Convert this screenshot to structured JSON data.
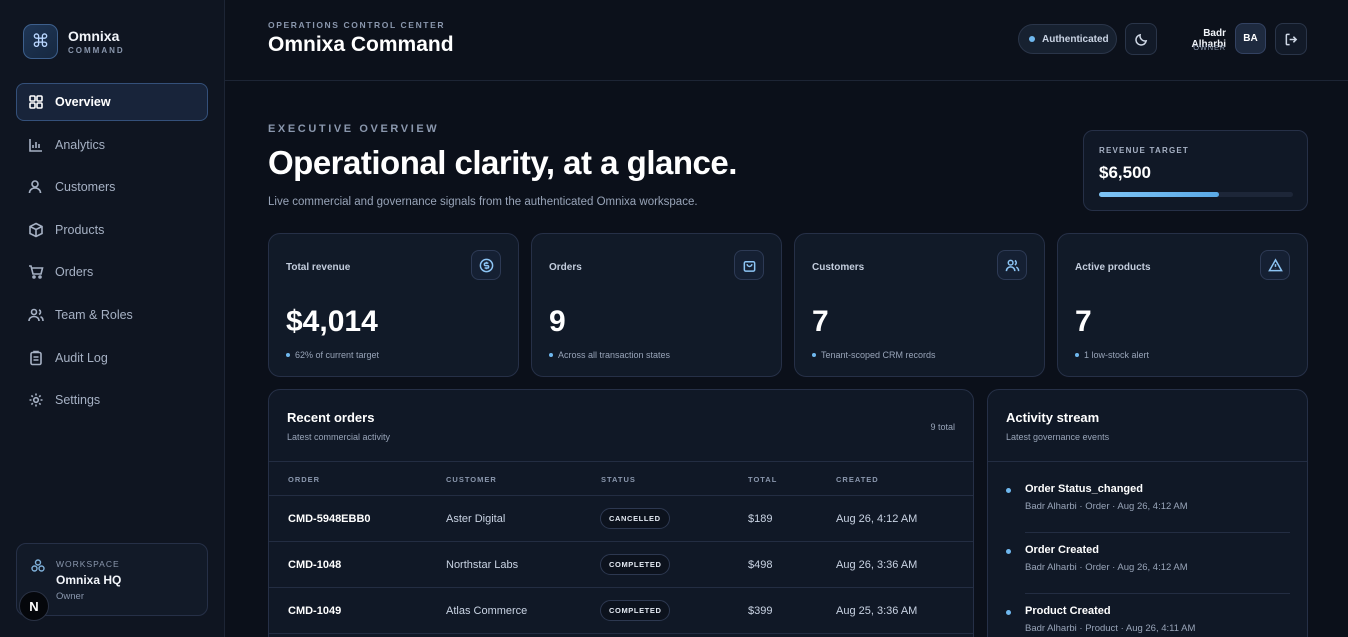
{
  "brand": {
    "name": "Omnixa",
    "subtitle": "COMMAND",
    "logo_icon": "command-icon"
  },
  "sidebar": {
    "items": [
      {
        "label": "Overview",
        "icon": "grid-icon",
        "active": true
      },
      {
        "label": "Analytics",
        "icon": "bar-chart-icon",
        "active": false
      },
      {
        "label": "Customers",
        "icon": "user-icon",
        "active": false
      },
      {
        "label": "Products",
        "icon": "box-icon",
        "active": false
      },
      {
        "label": "Orders",
        "icon": "cart-icon",
        "active": false
      },
      {
        "label": "Team & Roles",
        "icon": "team-icon",
        "active": false
      },
      {
        "label": "Audit Log",
        "icon": "clipboard-icon",
        "active": false
      },
      {
        "label": "Settings",
        "icon": "gear-icon",
        "active": false
      }
    ],
    "workspace": {
      "label": "WORKSPACE",
      "name": "Omnixa HQ",
      "role": "Owner"
    },
    "badge": "N"
  },
  "header": {
    "eyebrow": "OPERATIONS CONTROL CENTER",
    "title": "Omnixa Command",
    "auth_status": "Authenticated",
    "user": {
      "name": "Badr Alharbi",
      "role": "OWNER",
      "initials": "BA"
    }
  },
  "hero": {
    "eyebrow": "EXECUTIVE OVERVIEW",
    "title": "Operational clarity, at a glance.",
    "subtitle": "Live commercial and governance signals from the authenticated Omnixa workspace."
  },
  "revenue_target": {
    "label": "REVENUE TARGET",
    "value": "$6,500",
    "progress": 0.62
  },
  "stats": [
    {
      "label": "Total revenue",
      "value": "$4,014",
      "note": "62% of current target",
      "icon": "dollar-icon"
    },
    {
      "label": "Orders",
      "value": "9",
      "note": "Across all transaction states",
      "icon": "bag-icon"
    },
    {
      "label": "Customers",
      "value": "7",
      "note": "Tenant-scoped CRM records",
      "icon": "users-icon"
    },
    {
      "label": "Active products",
      "value": "7",
      "note": "1 low-stock alert",
      "icon": "alert-icon"
    }
  ],
  "orders": {
    "title": "Recent orders",
    "subtitle": "Latest commercial activity",
    "count": "9 total",
    "columns": [
      "ORDER",
      "CUSTOMER",
      "STATUS",
      "TOTAL",
      "CREATED"
    ],
    "rows": [
      {
        "order": "CMD-5948EBB0",
        "customer": "Aster Digital",
        "status": "CANCELLED",
        "total": "$189",
        "created": "Aug 26, 4:12 AM"
      },
      {
        "order": "CMD-1048",
        "customer": "Northstar Labs",
        "status": "COMPLETED",
        "total": "$498",
        "created": "Aug 26, 3:36 AM"
      },
      {
        "order": "CMD-1049",
        "customer": "Atlas Commerce",
        "status": "COMPLETED",
        "total": "$399",
        "created": "Aug 25, 3:36 AM"
      }
    ]
  },
  "activity": {
    "title": "Activity stream",
    "subtitle": "Latest governance events",
    "events": [
      {
        "title": "Order Status_changed",
        "meta": "Badr Alharbi · Order · Aug 26, 4:12 AM"
      },
      {
        "title": "Order Created",
        "meta": "Badr Alharbi · Order · Aug 26, 4:12 AM"
      },
      {
        "title": "Product Created",
        "meta": "Badr Alharbi · Product · Aug 26, 4:11 AM"
      }
    ]
  }
}
